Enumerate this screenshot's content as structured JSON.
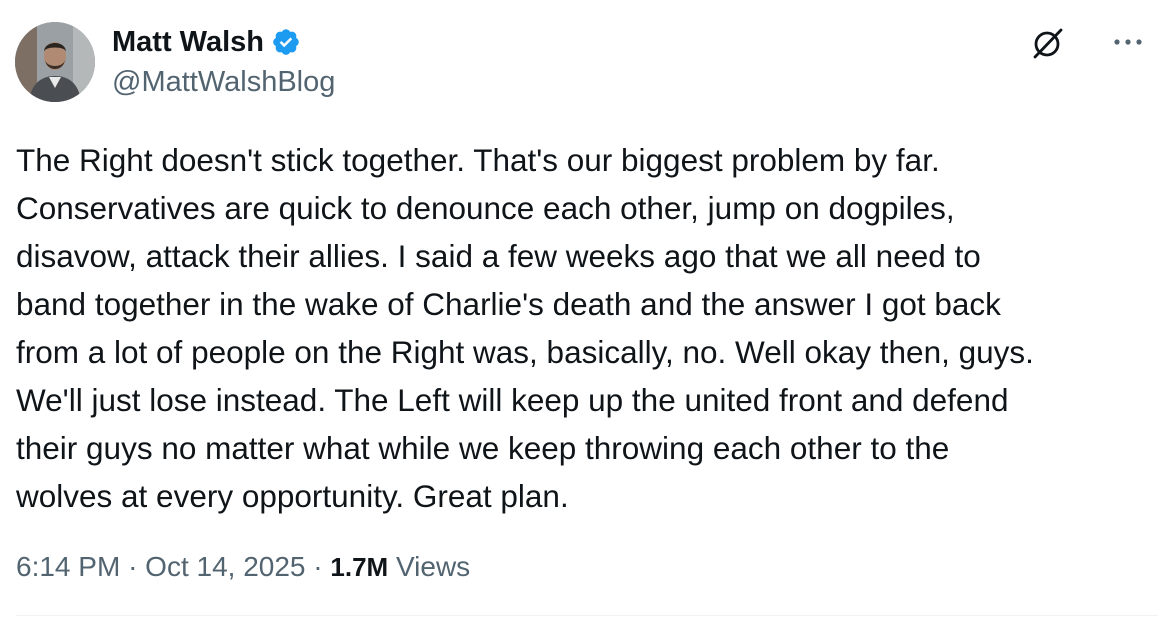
{
  "author": {
    "name": "Matt Walsh",
    "handle": "@MattWalshBlog",
    "verified": true,
    "verified_color": "#1d9bf0"
  },
  "header_actions": {
    "grok_icon": "grok-icon",
    "more_icon": "more-icon",
    "more_label": "···"
  },
  "tweet": {
    "lines": [
      "The Right doesn't stick together. That's our biggest problem by far.",
      "Conservatives are quick to denounce each other, jump on dogpiles,",
      "disavow, attack their allies. I said a few weeks ago that we all need to",
      "band together in the wake of Charlie's death and the answer I got back",
      "from a lot of people on the Right was, basically, no. Well okay then, guys.",
      "We'll just lose instead. The Left will keep up the united front and defend",
      "their guys no matter what while we keep throwing each other to the",
      "wolves at every opportunity. Great plan."
    ]
  },
  "meta": {
    "time": "6:14 PM",
    "separator": "·",
    "date": "Oct 14, 2025",
    "views_count": "1.7M",
    "views_label": "Views"
  },
  "colors": {
    "text_primary": "#0f1419",
    "text_secondary": "#536471",
    "divider": "#eff3f4"
  }
}
